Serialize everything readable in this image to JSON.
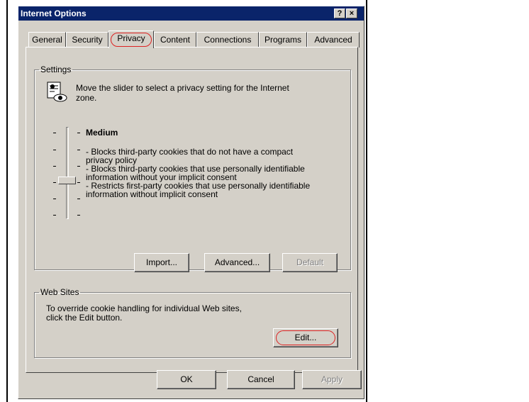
{
  "window": {
    "title": "Internet Options",
    "help_button": "?",
    "close_button": "×"
  },
  "tabs": [
    {
      "label": "General"
    },
    {
      "label": "Security"
    },
    {
      "label": "Privacy"
    },
    {
      "label": "Content"
    },
    {
      "label": "Connections"
    },
    {
      "label": "Programs"
    },
    {
      "label": "Advanced"
    }
  ],
  "privacy": {
    "settings_legend": "Settings",
    "intro_line1": "Move the slider to select a privacy setting for the Internet",
    "intro_line2": "zone.",
    "level_title": "Medium",
    "desc_lines": [
      "- Blocks third-party cookies that do not have a compact",
      "privacy policy",
      "- Blocks third-party cookies that use personally identifiable",
      "information without your implicit consent",
      "- Restricts first-party cookies that use personally identifiable",
      "information without implicit consent"
    ],
    "import_button": "Import...",
    "advanced_button": "Advanced...",
    "default_button": "Default",
    "websites_legend": "Web Sites",
    "websites_line1": "To override cookie handling for individual Web sites,",
    "websites_line2": "click the Edit button.",
    "edit_button": "Edit..."
  },
  "dialog_buttons": {
    "ok": "OK",
    "cancel": "Cancel",
    "apply": "Apply"
  }
}
